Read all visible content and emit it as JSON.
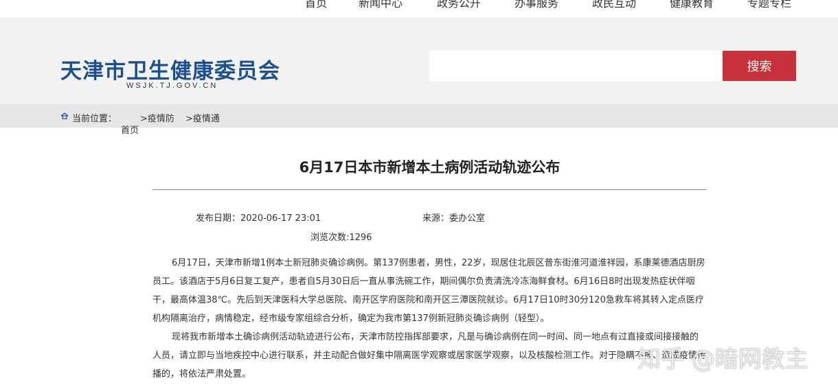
{
  "nav": {
    "items": [
      "首页",
      "新闻中心",
      "政务公开",
      "办事服务",
      "政民互动",
      "健康教育",
      "专题专栏"
    ]
  },
  "header": {
    "title": "天津市卫生健康委员会",
    "subtitle": "WSJK.TJ.GOV.CN",
    "search_placeholder": "",
    "search_button": "搜索"
  },
  "breadcrumb": {
    "label": "当前位置：",
    "home": "首页",
    "items": [
      ">疫情防",
      ">疫情通"
    ]
  },
  "article": {
    "title": "6月17日本市新增本土病例活动轨迹公布",
    "publish_date": "发布日期：2020-06-17 23:01",
    "source": "来源：委办公室",
    "views": "浏览次数:1296",
    "paragraphs": [
      "6月17日，天津市新增1例本土新冠肺炎确诊病例。第137例患者，男性，22岁，现居住北辰区普东街淮河道淮祥园，系康莱德酒店厨房员工。该酒店于5月6日复工复产，患者自5月30日后一直从事洗碗工作，期间偶尔负责清洗冷冻海鲜食材。6月16日8时出现发热症状伴咽干，最高体温38℃。先后到天津医科大学总医院、南开区学府医院和南开区三潭医院就诊。6月17日10时30分120急救车将其转入定点医疗机构隔离治疗，病情稳定，经市级专家组综合分析，确定为我市第137例新冠肺炎确诊病例（轻型）。",
      "现将我市新增本土确诊病例活动轨迹进行公布，天津市防控指挥部要求，凡是与确诊病例在同一时间、同一地点有过直接或间接接触的人员，请立即与当地疾控中心进行联系，并主动配合做好集中隔离医学观察或居家医学观察，以及核酸检测工作。对于隐瞒不报、造成疫情传播的，将依法严肃处置。"
    ]
  },
  "watermark": "知乎 @暗网教主",
  "colors": {
    "brand_blue": "#1c4f8f",
    "search_red": "#c8303a",
    "header_bg": "#f2f2f2",
    "crumb_bg": "#e6e6e6"
  }
}
